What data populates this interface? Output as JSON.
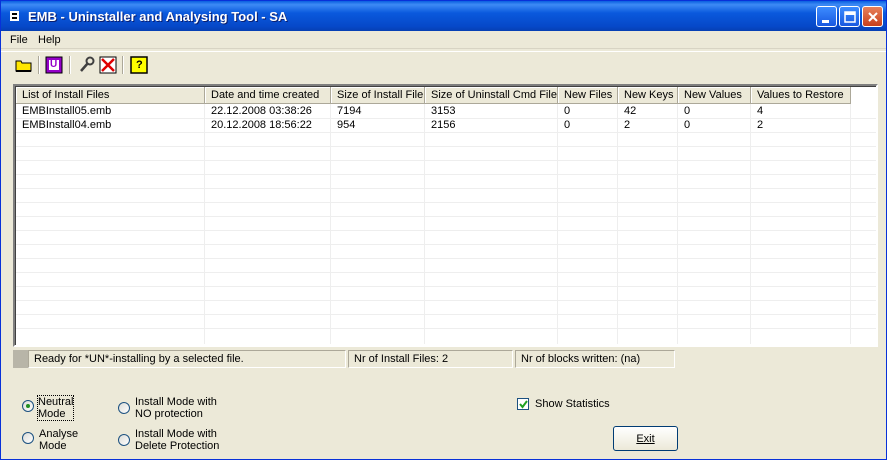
{
  "window": {
    "title": "EMB - Uninstaller and Analysing Tool - SA"
  },
  "menu": {
    "file": "File",
    "help": "Help"
  },
  "toolbar": {
    "icons": [
      "open-folder-icon",
      "uninstall-u-icon",
      "tools-icon",
      "delete-x-icon",
      "help-question-icon"
    ],
    "u_label": "U",
    "help_label": "?"
  },
  "list": {
    "columns": [
      "List of Install Files",
      "Date and time created",
      "Size of Install File",
      "Size of Uninstall Cmd File",
      "New Files",
      "New Keys",
      "New Values",
      "Values to Restore"
    ],
    "rows": [
      [
        "EMBInstall05.emb",
        "22.12.2008 03:38:26",
        "7194",
        "3153",
        "0",
        "42",
        "0",
        "4"
      ],
      [
        "EMBInstall04.emb",
        "20.12.2008 18:56:22",
        "954",
        "2156",
        "0",
        "2",
        "0",
        "2"
      ]
    ]
  },
  "status": {
    "message": "Ready for *UN*-installing by a selected file.",
    "install_files": "Nr of Install Files: 2",
    "blocks_written": "Nr of blocks written: (na)"
  },
  "modes": {
    "neutral_1": "Neutral",
    "neutral_2": "Mode",
    "analyse_1": "Analyse",
    "analyse_2": "Mode",
    "noprot_1": "Install Mode with",
    "noprot_2": "NO protection",
    "delprot_1": "Install Mode with",
    "delprot_2": "Delete Protection",
    "selected": "Neutral Mode"
  },
  "options": {
    "show_statistics": "Show Statistics",
    "show_statistics_checked": true
  },
  "buttons": {
    "exit": "Exit"
  }
}
